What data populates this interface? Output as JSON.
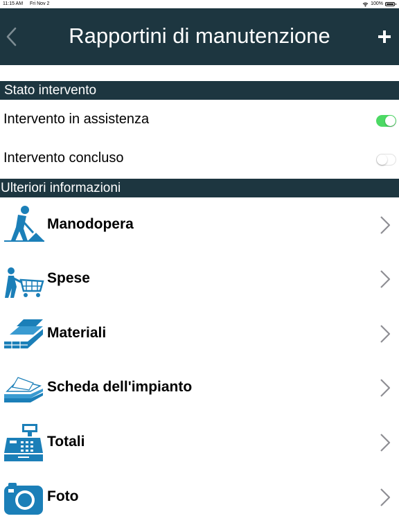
{
  "status_bar": {
    "time": "11:15 AM",
    "date": "Fri Nov 2",
    "battery": "100%"
  },
  "nav": {
    "title": "Rapportini di manutenzione",
    "back_icon": "chevron-left-icon",
    "add_icon": "plus-icon"
  },
  "sections": [
    {
      "title": "Stato intervento"
    },
    {
      "title": "Ulteriori informazioni"
    }
  ],
  "toggles": [
    {
      "label": "Intervento in assistenza",
      "on": true
    },
    {
      "label": "Intervento concluso",
      "on": false
    }
  ],
  "menu": [
    {
      "label": "Manodopera",
      "icon": "worker-shovel-icon"
    },
    {
      "label": "Spese",
      "icon": "shopping-cart-icon"
    },
    {
      "label": "Materiali",
      "icon": "bricks-icon"
    },
    {
      "label": "Scheda dell'impianto",
      "icon": "papers-stack-icon"
    },
    {
      "label": "Totali",
      "icon": "cash-register-icon"
    },
    {
      "label": "Foto",
      "icon": "camera-icon"
    }
  ],
  "colors": {
    "header": "#1d3640",
    "toggle_on": "#4cd964",
    "icon_blue": "#1b7fb8",
    "chevron": "#8e8e93"
  }
}
